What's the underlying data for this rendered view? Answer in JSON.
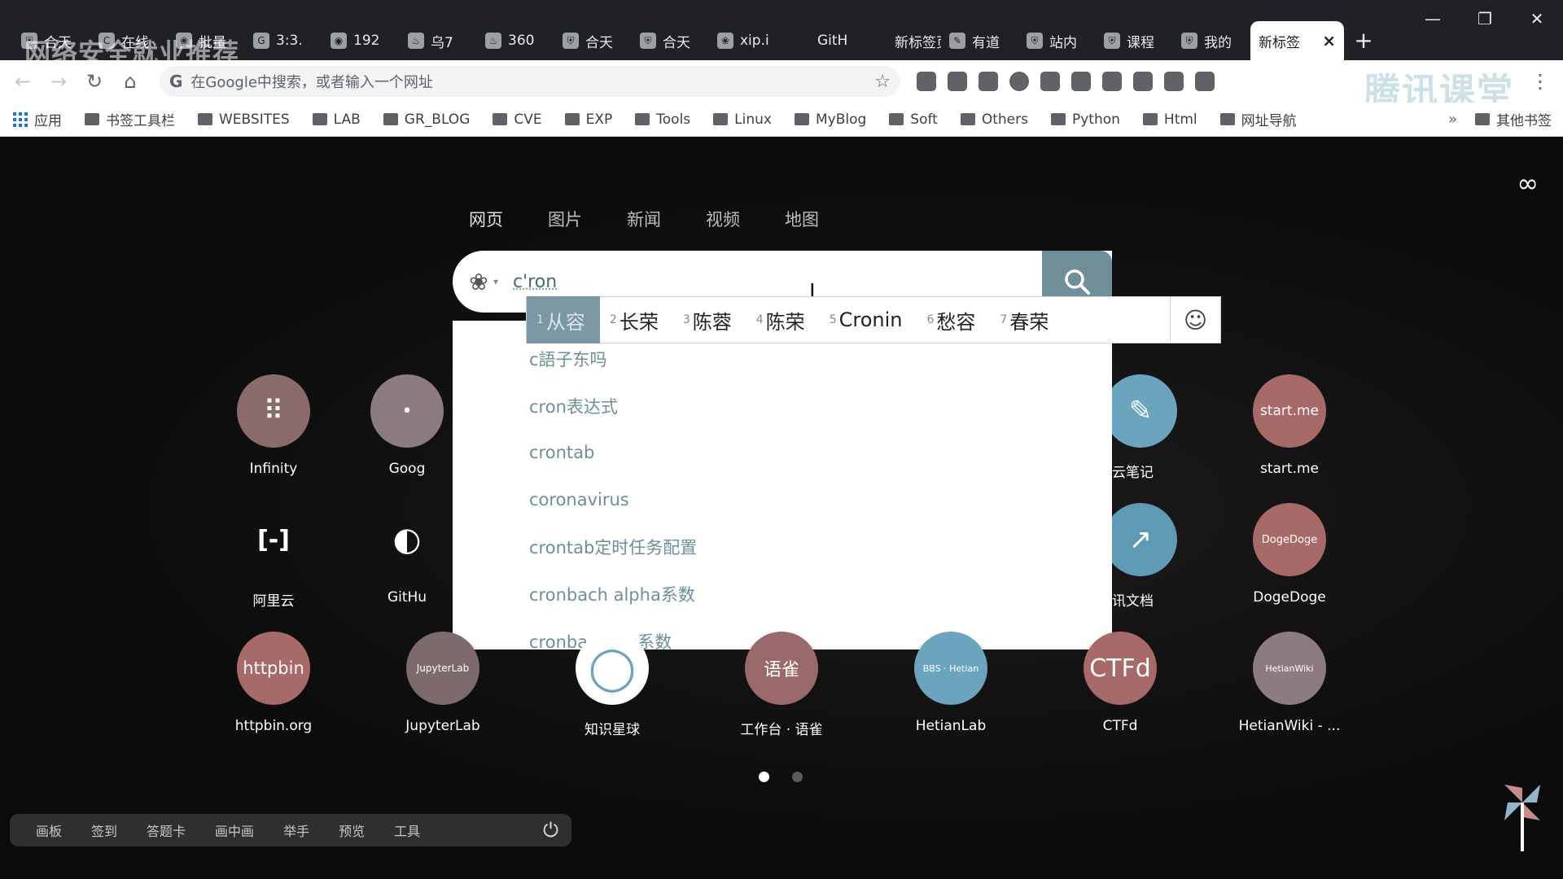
{
  "browser": {
    "overlay_watermark": "网络安全就业推荐",
    "tabs": [
      {
        "label": "合天",
        "icon": "shield-icon"
      },
      {
        "label": "在线",
        "icon": "c-logo-icon"
      },
      {
        "label": "批量",
        "icon": "paw-icon"
      },
      {
        "label": "3:3.",
        "icon": "g-logo-icon"
      },
      {
        "label": "192",
        "icon": "globe-icon"
      },
      {
        "label": "乌7",
        "icon": "flame-icon"
      },
      {
        "label": "360",
        "icon": "flame-icon"
      },
      {
        "label": "合天",
        "icon": "shield-icon"
      },
      {
        "label": "合天",
        "icon": "shield-icon"
      },
      {
        "label": "xip.i",
        "icon": "paw-icon"
      },
      {
        "label": "GitH",
        "icon": "github-icon"
      },
      {
        "label": "新标签页",
        "icon": "page-icon"
      },
      {
        "label": "有道",
        "icon": "note-icon"
      },
      {
        "label": "站内",
        "icon": "shield-icon"
      },
      {
        "label": "课程",
        "icon": "shield-icon"
      },
      {
        "label": "我的",
        "icon": "shield-icon"
      }
    ],
    "active_tab": {
      "label": "新标签",
      "close": "×"
    },
    "new_tab": "+",
    "window_controls": {
      "minimize": "—",
      "restore": "❐",
      "close": "✕"
    }
  },
  "toolbar": {
    "back": "←",
    "forward": "→",
    "reload": "↻",
    "home": "⌂",
    "omnibox_g": "G",
    "omnibox_placeholder": "在Google中搜索，或者输入一个网址",
    "bookmark_star": "☆",
    "tencent_watermark": "腾讯课堂",
    "menu": "⋮"
  },
  "bookmarks": {
    "apps_label": "应用",
    "items": [
      "书签工具栏",
      "WEBSITES",
      "LAB",
      "GR_BLOG",
      "CVE",
      "EXP",
      "Tools",
      "Linux",
      "MyBlog",
      "Soft",
      "Others",
      "Python",
      "Html",
      "网址导航"
    ],
    "overflow": "»",
    "other": "其他书签"
  },
  "newtab": {
    "infinity": "∞",
    "search_tabs": [
      "网页",
      "图片",
      "新闻",
      "视频",
      "地图"
    ],
    "query": "c'ron",
    "clear": "×",
    "ime_candidates": [
      {
        "n": "1",
        "text": "从容"
      },
      {
        "n": "2",
        "text": "长荣"
      },
      {
        "n": "3",
        "text": "陈蓉"
      },
      {
        "n": "4",
        "text": "陈荣"
      },
      {
        "n": "5",
        "text": "Cronin"
      },
      {
        "n": "6",
        "text": "愁容"
      },
      {
        "n": "7",
        "text": "春荣"
      }
    ],
    "ime_emoji": "☺",
    "suggestions": [
      "c語子东吗",
      "cron表达式",
      "crontab",
      "coronavirus",
      "crontab定时任务配置",
      "cronbach alpha系数",
      "cronbach's a系数"
    ],
    "dials": [
      {
        "label": "Infinity",
        "glyph": "⠿",
        "color": "#8a6a6a"
      },
      {
        "label": "Goog",
        "glyph": "•",
        "color": "#8c7b80"
      },
      {
        "label": "云笔记",
        "glyph": "✎",
        "color": "#6aa5bd"
      },
      {
        "label": "start.me",
        "glyph": "start.me",
        "color": "#a86a68"
      },
      {
        "label": "阿里云",
        "glyph": "[-]",
        "color": "transparent"
      },
      {
        "label": "GitHu",
        "glyph": "◐",
        "color": "transparent"
      },
      {
        "label": "讯文档",
        "glyph": "↗",
        "color": "#5e9ab3"
      },
      {
        "label": "DogeDoge",
        "glyph": "DogeDoge",
        "color": "#a86a68"
      },
      {
        "label": "httpbin.org",
        "glyph": "httpbin",
        "color": "#a86a68"
      },
      {
        "label": "JupyterLab",
        "glyph": "JupyterLab",
        "color": "#7d6a6a"
      },
      {
        "label": "知识星球",
        "glyph": "◯",
        "color": "#ffffff"
      },
      {
        "label": "工作台 · 语雀",
        "glyph": "语雀",
        "color": "#9a6a6a"
      },
      {
        "label": "HetianLab",
        "glyph": "BBS · Hetian",
        "color": "#6aa5bd"
      },
      {
        "label": "CTFd",
        "glyph": "CTFd",
        "color": "#a86a68"
      },
      {
        "label": "HetianWiki - ...",
        "glyph": "HetianWiki",
        "color": "#8c7b80"
      }
    ],
    "page_dots": [
      "active",
      "inactive"
    ],
    "bottom_bar": [
      "画板",
      "签到",
      "答题卡",
      "画中画",
      "举手",
      "预览",
      "工具"
    ],
    "power": "⏻"
  },
  "colors": {
    "tabstrip": "#202124",
    "search_button": "#6f8e98",
    "suggestion_text": "#6d8e9a",
    "ime_selected": "#7a98a3"
  }
}
